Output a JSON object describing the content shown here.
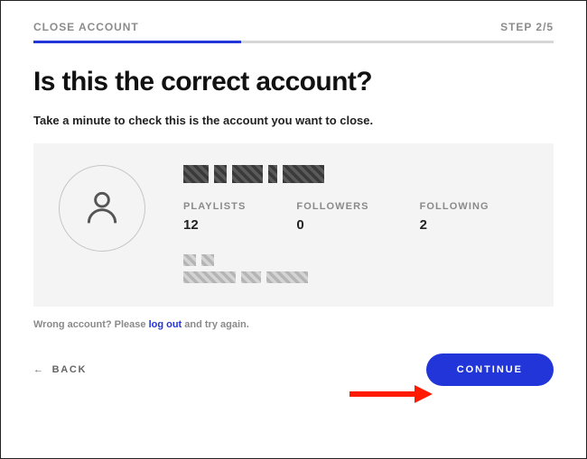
{
  "header": {
    "title": "CLOSE ACCOUNT",
    "step_label": "STEP 2/5",
    "progress_percent": 40
  },
  "page": {
    "heading": "Is this the correct account?",
    "subtitle": "Take a minute to check this is the account you want to close."
  },
  "account": {
    "display_name_redacted": true,
    "stats": {
      "playlists": {
        "label": "PLAYLISTS",
        "value": "12"
      },
      "followers": {
        "label": "FOLLOWERS",
        "value": "0"
      },
      "following": {
        "label": "FOLLOWING",
        "value": "2"
      }
    },
    "meta_redacted": true
  },
  "hint": {
    "prefix": "Wrong account? Please ",
    "link_text": "log out",
    "suffix": " and try again."
  },
  "buttons": {
    "back": "BACK",
    "continue": "CONTINUE"
  },
  "colors": {
    "primary": "#2235d8"
  }
}
